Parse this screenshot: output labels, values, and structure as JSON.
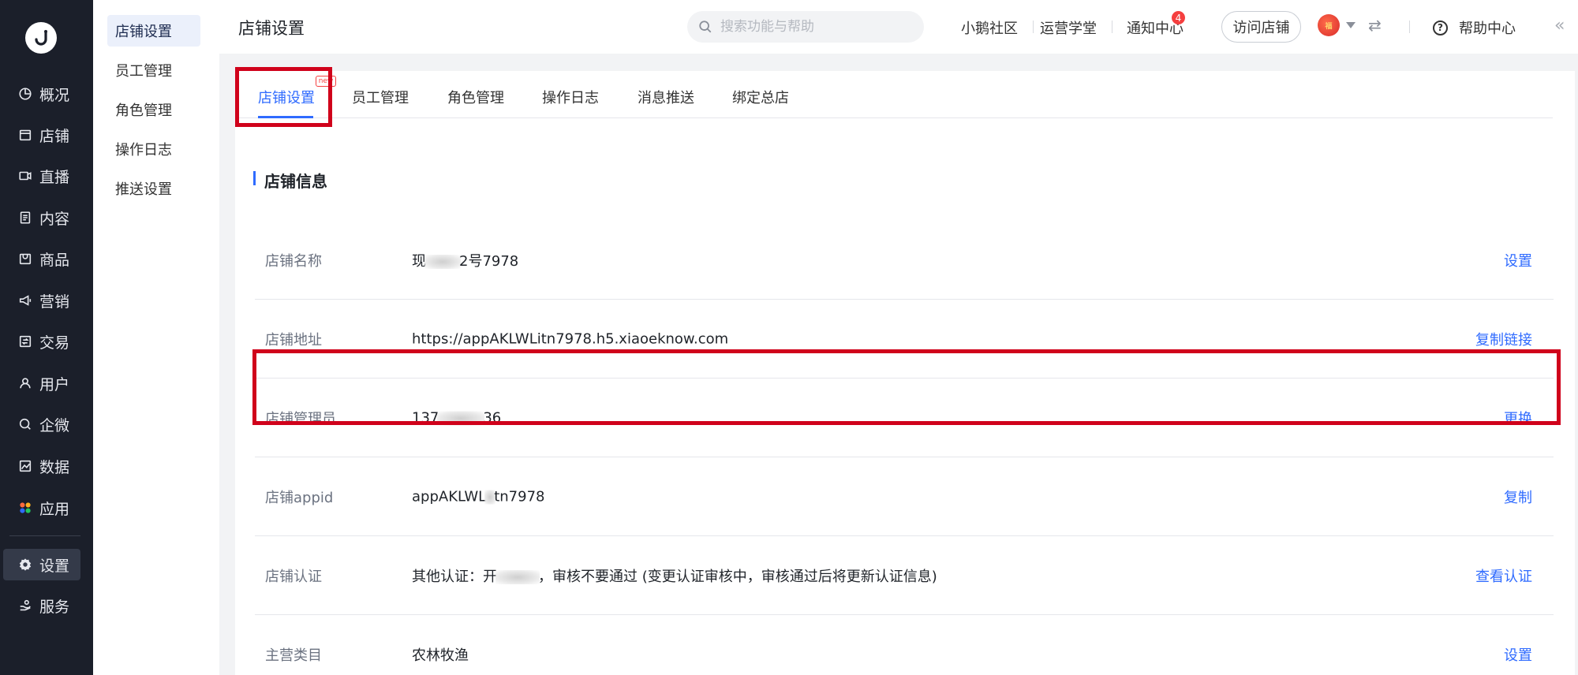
{
  "nav": {
    "items": [
      {
        "label": "概况",
        "icon": "dashboard-icon"
      },
      {
        "label": "店铺",
        "icon": "store-icon"
      },
      {
        "label": "直播",
        "icon": "live-icon"
      },
      {
        "label": "内容",
        "icon": "content-icon"
      },
      {
        "label": "商品",
        "icon": "product-icon"
      },
      {
        "label": "营销",
        "icon": "megaphone-icon"
      },
      {
        "label": "交易",
        "icon": "transaction-icon"
      },
      {
        "label": "用户",
        "icon": "user-icon"
      },
      {
        "label": "企微",
        "icon": "wecom-icon"
      },
      {
        "label": "数据",
        "icon": "data-icon"
      },
      {
        "label": "应用",
        "icon": "apps-icon"
      },
      {
        "label": "设置",
        "icon": "gear-icon"
      },
      {
        "label": "服务",
        "icon": "service-icon"
      }
    ],
    "active": "设置"
  },
  "subnav": {
    "items": [
      "店铺设置",
      "员工管理",
      "角色管理",
      "操作日志",
      "推送设置"
    ],
    "active": "店铺设置"
  },
  "header": {
    "title": "店铺设置",
    "search_placeholder": "搜索功能与帮助",
    "links": [
      "小鹅社区",
      "运营学堂",
      "通知中心"
    ],
    "notification_count": "4",
    "visit_button": "访问店铺",
    "help": "帮助中心"
  },
  "tabs": {
    "items": [
      "店铺设置",
      "员工管理",
      "角色管理",
      "操作日志",
      "消息推送",
      "绑定总店"
    ],
    "active": "店铺设置",
    "new_tag": "new"
  },
  "section": {
    "title": "店铺信息",
    "rows": [
      {
        "label": "店铺名称",
        "value_a": "现",
        "value_b": "2号7978",
        "action": "设置"
      },
      {
        "label": "店铺地址",
        "value": "https://appAKLWLitn7978.h5.xiaoeknow.com",
        "action": "复制链接"
      },
      {
        "label": "店铺管理员",
        "value_a": "137",
        "value_b": "36",
        "action": "更换"
      },
      {
        "label": "店铺appid",
        "value_a": "appAKLWL",
        "value_b": "tn7978",
        "action": "复制"
      },
      {
        "label": "店铺认证",
        "value_a": "其他认证：开",
        "value_b": "，审核不要通过 (变更认证审核中，审核通过后将更新认证信息)",
        "action": "查看认证"
      },
      {
        "label": "主营类目",
        "value": "农林牧渔",
        "action": "设置"
      }
    ]
  },
  "colors": {
    "accent": "#2f6bff",
    "highlight": "#d0021b",
    "nav_bg": "#1b1f2a"
  }
}
